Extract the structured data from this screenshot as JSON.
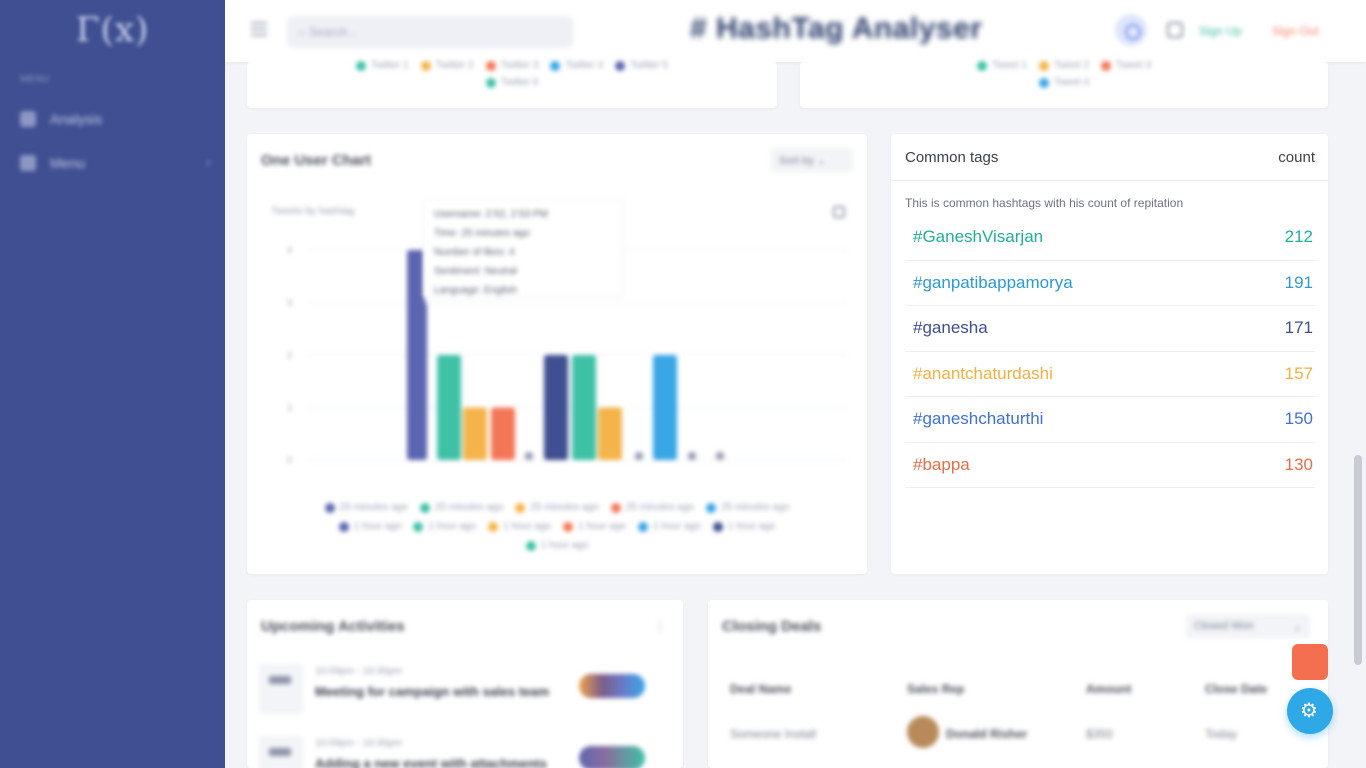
{
  "sidebar": {
    "logo": "Γ(x)",
    "section": "MENU",
    "items": [
      {
        "label": "Analysis",
        "icon": "dashboard-icon"
      },
      {
        "label": "Menu",
        "icon": "grid-icon"
      }
    ]
  },
  "topbar": {
    "search_placeholder": "Search...",
    "title": "# HashTag Analyser",
    "link_signup": "Sign Up",
    "link_signout": "Sign Out"
  },
  "top_left_card": {
    "legend_row1": [
      "Twitter 1",
      "Twitter 2",
      "Twitter 3",
      "Twitter 4",
      "Twitter 5"
    ],
    "legend_row2": [
      "Twitter 6"
    ],
    "legend_colors": [
      "#3fc1a6",
      "#f4b44a",
      "#f37757",
      "#39a6e6",
      "#5c66b0"
    ]
  },
  "top_right_card": {
    "legend_row1": [
      "Tweet 1",
      "Tweet 2",
      "Tweet 3"
    ],
    "legend_row2": [
      "Tweet 4"
    ],
    "legend_colors": [
      "#3fc1a6",
      "#f4b44a",
      "#f37757",
      "#39a6e6"
    ]
  },
  "chart_card": {
    "title": "One User Chart",
    "dropdown": "Sort by",
    "subtitle": "Tweets by hashtag",
    "tooltip": [
      "Username: 2:52, 2:53 PM",
      "Time: 25 minutes ago",
      "Number of likes: 4",
      "Sentiment: Neutral",
      "Language: English"
    ],
    "colors": [
      "#5c66b0",
      "#3fc1a6",
      "#f4b44a",
      "#f37757",
      "#39a6e6",
      "#3f4f91",
      "#9aa0b4"
    ],
    "legend_row1": [
      "25 minutes ago",
      "25 minutes ago",
      "25 minutes ago",
      "25 minutes ago",
      "25 minutes ago"
    ],
    "legend_row2": [
      "1 hour ago",
      "1 hour ago",
      "1 hour ago",
      "1 hour ago",
      "1 hour ago",
      "1 hour ago"
    ],
    "legend_row3": [
      "1 hour ago"
    ]
  },
  "chart_data": {
    "type": "bar",
    "title": "",
    "xlabel": "",
    "ylabel": "",
    "ylim": [
      0,
      4
    ],
    "yticks": [
      0,
      1,
      2,
      3,
      4
    ],
    "grid": true,
    "legend_position": "bottom",
    "values": [
      4,
      3,
      2,
      1,
      1,
      0,
      2,
      2,
      1,
      0,
      2,
      0,
      0
    ],
    "bar_colors": [
      "#5c66b0",
      "#5c66b0",
      "#3fc1a6",
      "#f4b44a",
      "#f37757",
      "#9aa0b4",
      "#3f4f91",
      "#3fc1a6",
      "#f4b44a",
      "#9aa0b4",
      "#39a6e6",
      "#9aa0b4",
      "#9aa0b4"
    ]
  },
  "common_tags": {
    "title": "Common tags",
    "count_header": "count",
    "description": "This is common hashtags with his count of repitation",
    "rows": [
      {
        "tag": "#GaneshVisarjan",
        "count": "212",
        "color": "#22ae97"
      },
      {
        "tag": "#ganpatibappamorya",
        "count": "191",
        "color": "#2d9ad6"
      },
      {
        "tag": "#ganesha",
        "count": "171",
        "color": "#3f4f91"
      },
      {
        "tag": "#anantchaturdashi",
        "count": "157",
        "color": "#f2b040"
      },
      {
        "tag": "#ganeshchaturthi",
        "count": "150",
        "color": "#3f72d6"
      },
      {
        "tag": "#bappa",
        "count": "130",
        "color": "#ea6b4a"
      }
    ]
  },
  "activities": {
    "title": "Upcoming Activities",
    "items": [
      {
        "sub": "10:00pm - 10:30pm",
        "text": "Meeting for campaign with sales team"
      },
      {
        "sub": "10:00pm - 10:30pm",
        "text": "Adding a new event with attachments"
      }
    ]
  },
  "deals": {
    "title": "Closing Deals",
    "filter": "Closed Won",
    "headers": [
      "Deal Name",
      "Sales Rep",
      "Amount",
      "Close Date"
    ],
    "row": [
      "Someone Install",
      "Donald Risher",
      "$350",
      "Today"
    ]
  }
}
